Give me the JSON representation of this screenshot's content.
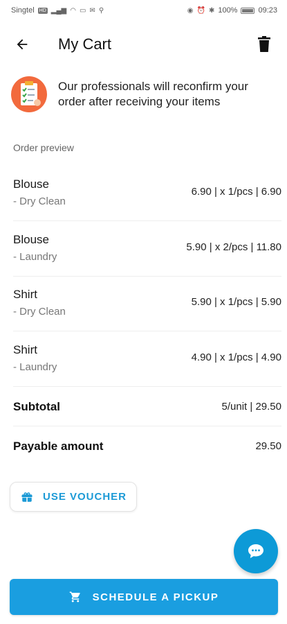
{
  "status_bar": {
    "carrier": "Singtel",
    "network_badge": "HD",
    "battery_percent": "100%",
    "time": "09:23"
  },
  "header": {
    "title": "My Cart"
  },
  "notice": {
    "text": "Our professionals will reconfirm your order after receiving your items"
  },
  "order_preview": {
    "label": "Order preview",
    "items": [
      {
        "name": "Blouse",
        "service": "- Dry Clean",
        "price_line": "6.90 | x 1/pcs | 6.90"
      },
      {
        "name": "Blouse",
        "service": "- Laundry",
        "price_line": "5.90 | x 2/pcs | 11.80"
      },
      {
        "name": "Shirt",
        "service": "- Dry Clean",
        "price_line": "5.90 | x 1/pcs | 5.90"
      },
      {
        "name": "Shirt",
        "service": "- Laundry",
        "price_line": "4.90 | x 1/pcs | 4.90"
      }
    ]
  },
  "summary": {
    "subtotal_label": "Subtotal",
    "subtotal_value": "5/unit | 29.50",
    "payable_label": "Payable amount",
    "payable_value": "29.50"
  },
  "voucher": {
    "label": "USE VOUCHER"
  },
  "actions": {
    "schedule_label": "SCHEDULE A PICKUP"
  },
  "colors": {
    "accent": "#1a9ee0",
    "fab": "#0d9ad7"
  }
}
